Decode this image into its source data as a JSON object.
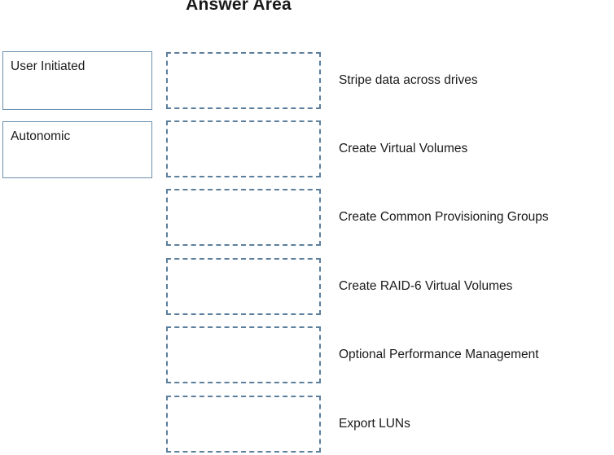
{
  "title": "Answer Area",
  "source_tokens": [
    {
      "label": "User Initiated"
    },
    {
      "label": "Autonomic"
    }
  ],
  "rows": [
    {
      "slot_value": "",
      "option_label": "Stripe data across drives"
    },
    {
      "slot_value": "",
      "option_label": "Create Virtual Volumes"
    },
    {
      "slot_value": "",
      "option_label": "Create Common Provisioning Groups"
    },
    {
      "slot_value": "",
      "option_label": "Create RAID-6 Virtual Volumes"
    },
    {
      "slot_value": "",
      "option_label": "Optional Performance Management"
    },
    {
      "slot_value": "",
      "option_label": "Export LUNs"
    }
  ],
  "colors": {
    "source_border": "#6b8faf",
    "slot_border": "#5c7f9e",
    "text": "#1a1a1a",
    "background": "#ffffff"
  }
}
